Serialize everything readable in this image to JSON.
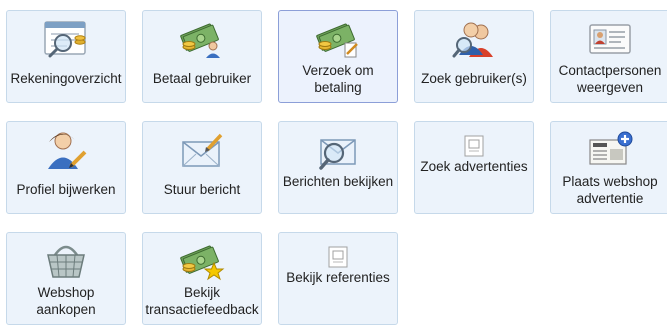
{
  "tiles": [
    {
      "key": "rekeningoverzicht",
      "label": "Rekeningoverzicht",
      "icon": "account-overview-icon"
    },
    {
      "key": "betaal-gebruiker",
      "label": "Betaal gebruiker",
      "icon": "pay-user-icon"
    },
    {
      "key": "verzoek-om-betaling",
      "label": "Verzoek om betaling",
      "icon": "payment-request-icon",
      "selected": true
    },
    {
      "key": "zoek-gebruikers",
      "label": "Zoek gebruiker(s)",
      "icon": "search-users-icon"
    },
    {
      "key": "contactpersonen-weergeven",
      "label": "Contactpersonen weergeven",
      "icon": "contact-card-icon"
    },
    {
      "key": "profiel-bijwerken",
      "label": "Profiel bijwerken",
      "icon": "edit-profile-icon"
    },
    {
      "key": "stuur-bericht",
      "label": "Stuur bericht",
      "icon": "send-message-icon"
    },
    {
      "key": "berichten-bekijken",
      "label": "Berichten bekijken",
      "icon": "view-messages-icon"
    },
    {
      "key": "zoek-advertenties",
      "label": "Zoek advertenties",
      "icon": "broken-image-icon"
    },
    {
      "key": "plaats-webshop-advertentie",
      "label": "Plaats webshop advertentie",
      "icon": "newspaper-add-icon"
    },
    {
      "key": "webshop-aankopen",
      "label": "Webshop aankopen",
      "icon": "shopping-basket-icon"
    },
    {
      "key": "bekijk-transactiefeedback",
      "label": "Bekijk transactiefeedback",
      "icon": "transaction-feedback-icon"
    },
    {
      "key": "bekijk-referenties",
      "label": "Bekijk referenties",
      "icon": "broken-image-icon"
    }
  ]
}
